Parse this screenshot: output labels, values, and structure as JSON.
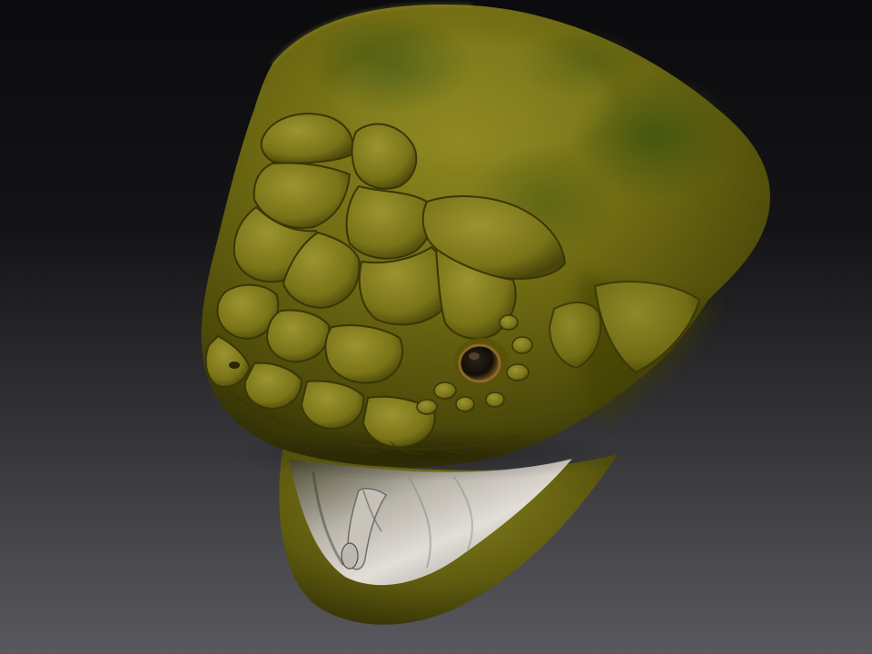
{
  "scene": {
    "subject": "snake-head-sculpt",
    "colors": {
      "background_top": "#0b0b0d",
      "background_bottom": "#58585e",
      "skin_base": "#6f6a12",
      "skin_light": "#8f8a28",
      "skin_dark": "#3e3c08",
      "skin_green": "#4b5a12",
      "mouth_inner": "#d6d2cc",
      "mouth_shadow": "#2c2a24",
      "eye": "#1e1810",
      "eye_rim": "#8a6a2a"
    }
  }
}
